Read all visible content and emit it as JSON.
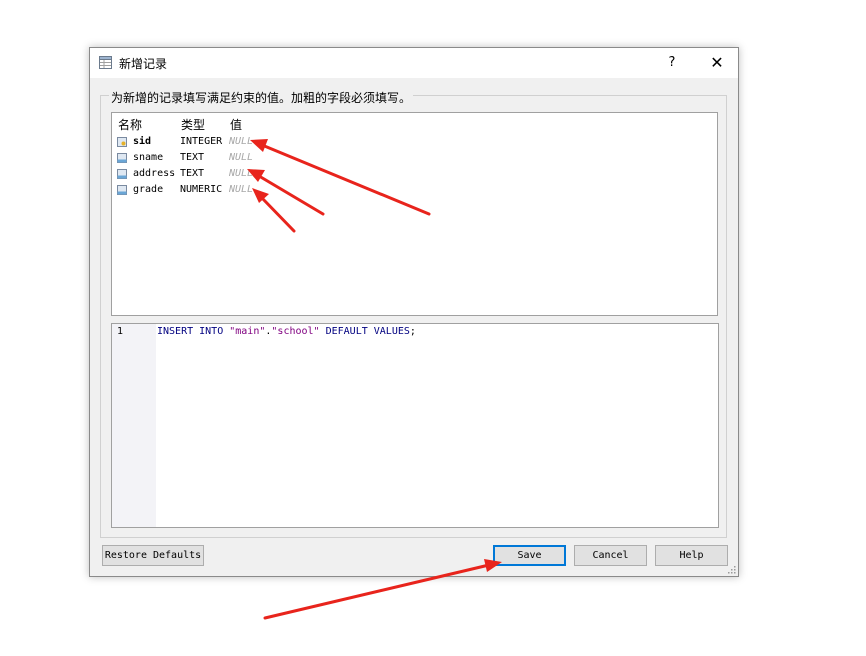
{
  "window": {
    "title": "新增记录",
    "help_label": "?",
    "close_label": "✕"
  },
  "group": {
    "legend": "为新增的记录填写满足约束的值。加粗的字段必须填写。"
  },
  "fields": {
    "headers": {
      "name": "名称",
      "type": "类型",
      "value": "值"
    },
    "rows": [
      {
        "name": "sid",
        "type": "INTEGER",
        "value": "NULL",
        "bold": true,
        "icon": "key-field-icon"
      },
      {
        "name": "sname",
        "type": "TEXT",
        "value": "NULL",
        "bold": false,
        "icon": "field-icon"
      },
      {
        "name": "address",
        "type": "TEXT",
        "value": "NULL",
        "bold": false,
        "icon": "field-icon"
      },
      {
        "name": "grade",
        "type": "NUMERIC",
        "value": "NULL",
        "bold": false,
        "icon": "field-icon"
      }
    ]
  },
  "sql": {
    "line_number": "1",
    "kw1": "INSERT INTO ",
    "str1": "\"main\"",
    "dot": ".",
    "str2": "\"school\"",
    "kw2": " DEFAULT VALUES",
    "end": ";"
  },
  "buttons": {
    "restore": "Restore Defaults",
    "save": "Save",
    "cancel": "Cancel",
    "help": "Help"
  },
  "colors": {
    "annotation_arrow": "#e8241c",
    "keyword": "#000080",
    "string": "#800080",
    "default_button_border": "#0078d7"
  }
}
